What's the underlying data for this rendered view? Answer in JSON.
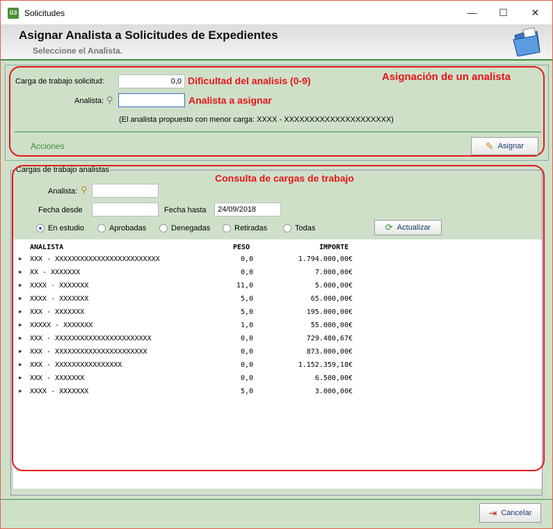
{
  "window": {
    "title": "Solicitudes",
    "controls": {
      "minimize": "—",
      "maximize": "☐",
      "close": "✕"
    }
  },
  "header": {
    "title": "Asignar Analista a Solicitudes de Expedientes",
    "subtitle": "Seleccione el Analista.",
    "icon": "folder-icon"
  },
  "assign": {
    "workload_label": "Carga de trabajo solicitud:",
    "workload_value": "0,0",
    "analyst_label": "Analista:",
    "analyst_value": "",
    "proposed_text": "(El analista propuesto con menor carga:  XXXX - XXXXXXXXXXXXXXXXXXXXX)",
    "actions_label": "Acciones",
    "assign_button": "Asignar"
  },
  "annotations": {
    "difficulty": "Dificultad del analisis (0-9)",
    "analyst_to_assign": "Analista a asignar",
    "assignment_title": "Asignación de un analista",
    "workload_query_title": "Consulta de cargas de trabajo"
  },
  "workloads": {
    "group_title": "Cargas de trabajo analistas",
    "analyst_label": "Analista:",
    "analyst_value": "",
    "from_label": "Fecha desde",
    "from_value": "",
    "to_label": "Fecha hasta",
    "to_value": "24/09/2018",
    "filters": [
      {
        "label": "En estudio",
        "selected": true
      },
      {
        "label": "Aprobadas",
        "selected": false
      },
      {
        "label": "Denegadas",
        "selected": false
      },
      {
        "label": "Retiradas",
        "selected": false
      },
      {
        "label": "Todas",
        "selected": false
      }
    ],
    "refresh_button": "Actualizar",
    "columns": [
      "ANALISTA",
      "PESO",
      "IMPORTE"
    ],
    "rows": [
      {
        "analista": "XXX - XXXXXXXXXXXXXXXXXXXXXXXXX",
        "peso": "0,0",
        "importe": "1.794.000,00€"
      },
      {
        "analista": "XX - XXXXXXX",
        "peso": "0,0",
        "importe": "7.000,00€"
      },
      {
        "analista": "XXXX - XXXXXXX",
        "peso": "11,0",
        "importe": "5.000,00€"
      },
      {
        "analista": "XXXX - XXXXXXX",
        "peso": "5,0",
        "importe": "65.000,00€"
      },
      {
        "analista": "XXX - XXXXXXX",
        "peso": "5,0",
        "importe": "195.000,00€"
      },
      {
        "analista": "XXXXX - XXXXXXX",
        "peso": "1,0",
        "importe": "55.000,00€"
      },
      {
        "analista": "XXX - XXXXXXXXXXXXXXXXXXXXXXX",
        "peso": "0,0",
        "importe": "729.480,67€"
      },
      {
        "analista": "XXX - XXXXXXXXXXXXXXXXXXXXXX",
        "peso": "0,0",
        "importe": "873.000,00€"
      },
      {
        "analista": "XXX - XXXXXXXXXXXXXXXX",
        "peso": "0,0",
        "importe": "1.152.359,18€"
      },
      {
        "analista": "XXX - XXXXXXX",
        "peso": "0,0",
        "importe": "6.500,00€"
      },
      {
        "analista": "XXXX - XXXXXXX",
        "peso": "5,0",
        "importe": "3.000,00€"
      }
    ]
  },
  "footer": {
    "cancel_button": "Cancelar"
  }
}
